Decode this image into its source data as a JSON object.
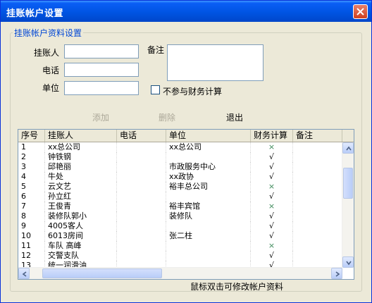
{
  "window": {
    "title": "挂账帐户设置"
  },
  "group": {
    "legend": "挂账帐户资料设置"
  },
  "form": {
    "person_label": "挂账人",
    "phone_label": "电话",
    "unit_label": "单位",
    "remark_label": "备注",
    "person_value": "",
    "phone_value": "",
    "unit_value": "",
    "remark_value": "",
    "exclude_finance_label": "不参与财务计算",
    "exclude_finance_checked": false
  },
  "buttons": {
    "add": "添加",
    "delete": "删除",
    "exit": "退出"
  },
  "table": {
    "headers": [
      "序号",
      "挂账人",
      "电话",
      "单位",
      "财务计算",
      "备注"
    ],
    "rows": [
      [
        "1",
        "xx总公司",
        "",
        "xx总公司",
        "×",
        ""
      ],
      [
        "2",
        "钟铁钢",
        "",
        "",
        "√",
        ""
      ],
      [
        "3",
        "邱艳丽",
        "",
        "市政服务中心",
        "√",
        ""
      ],
      [
        "4",
        "牛处",
        "",
        "xx政协",
        "√",
        ""
      ],
      [
        "5",
        "云文艺",
        "",
        "裕丰总公司",
        "×",
        ""
      ],
      [
        "6",
        "孙立红",
        "",
        "",
        "√",
        ""
      ],
      [
        "7",
        "王俊青",
        "",
        "裕丰宾馆",
        "×",
        ""
      ],
      [
        "8",
        "装修队郭小",
        "",
        "装修队",
        "√",
        ""
      ],
      [
        "9",
        "4005客人",
        "",
        "",
        "√",
        ""
      ],
      [
        "10",
        "6013房间",
        "",
        "张二柱",
        "√",
        ""
      ],
      [
        "11",
        "车队 高峰",
        "",
        "",
        "×",
        ""
      ],
      [
        "12",
        "交警支队",
        "",
        "",
        "√",
        ""
      ],
      [
        "13",
        "统一润滑油",
        "",
        "",
        "√",
        ""
      ]
    ]
  },
  "status": {
    "hint": "鼠标双击可修改帐户资料"
  },
  "colors": {
    "title_bar": "#0054e3",
    "legend_text": "#0046d5",
    "disabled_text": "#aca899",
    "cross_mark": "#3c8a5a"
  }
}
